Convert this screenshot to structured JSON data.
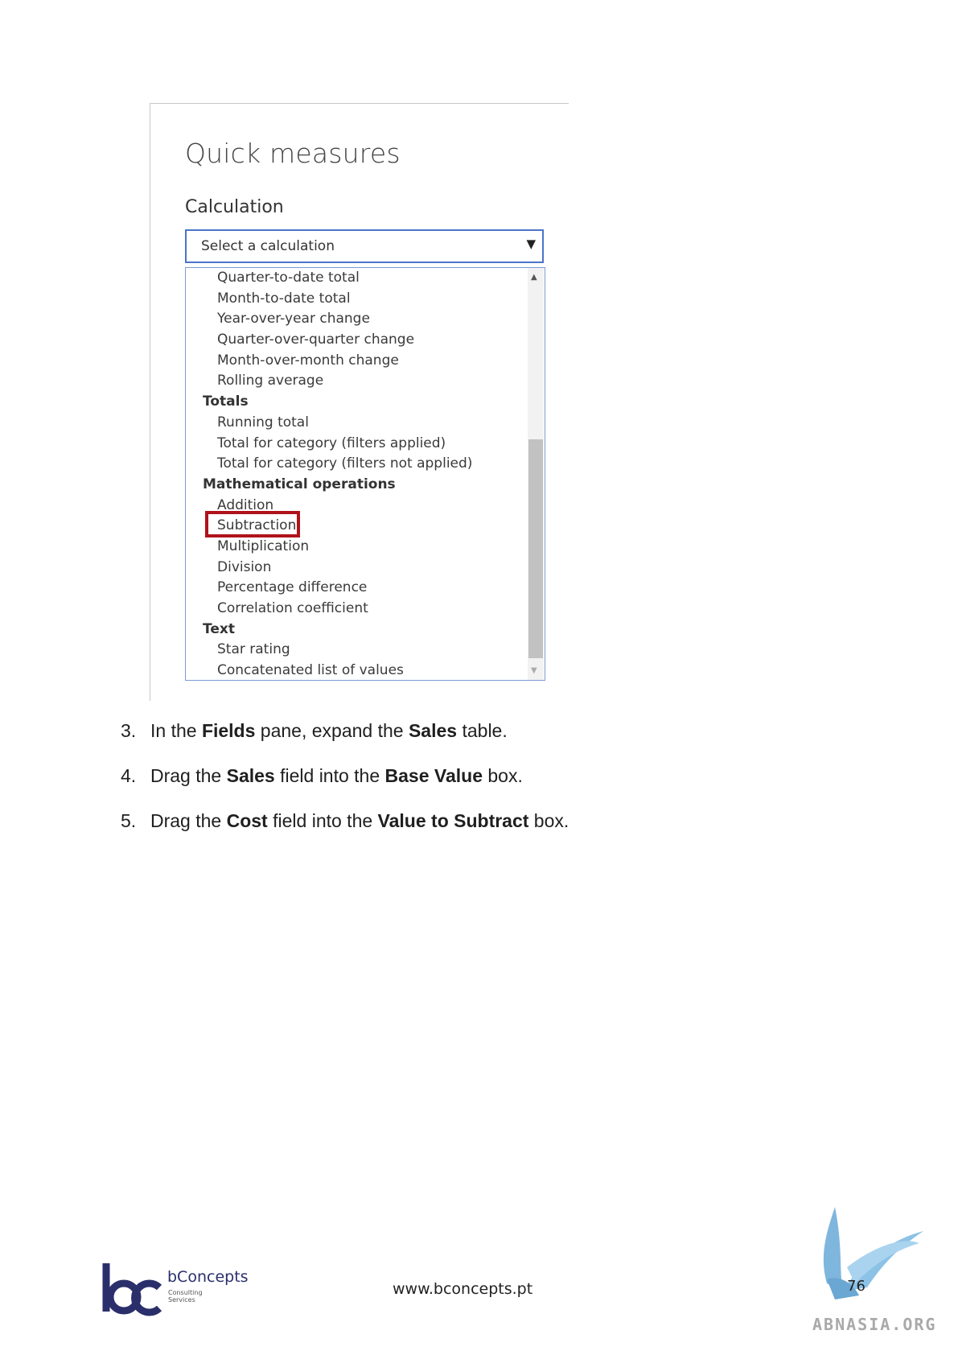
{
  "dialog": {
    "title": "Quick measures",
    "calculation_label": "Calculation",
    "select_placeholder": "Select a calculation",
    "list": [
      {
        "type": "item",
        "label": "Quarter-to-date total"
      },
      {
        "type": "item",
        "label": "Month-to-date total"
      },
      {
        "type": "item",
        "label": "Year-over-year change"
      },
      {
        "type": "item",
        "label": "Quarter-over-quarter change"
      },
      {
        "type": "item",
        "label": "Month-over-month change"
      },
      {
        "type": "item",
        "label": "Rolling average"
      },
      {
        "type": "group",
        "label": "Totals"
      },
      {
        "type": "item",
        "label": "Running total"
      },
      {
        "type": "item",
        "label": "Total for category (filters applied)"
      },
      {
        "type": "item",
        "label": "Total for category (filters not applied)"
      },
      {
        "type": "group",
        "label": "Mathematical operations"
      },
      {
        "type": "item",
        "label": "Addition"
      },
      {
        "type": "item",
        "label": "Subtraction",
        "highlighted": true
      },
      {
        "type": "item",
        "label": "Multiplication"
      },
      {
        "type": "item",
        "label": "Division"
      },
      {
        "type": "item",
        "label": "Percentage difference"
      },
      {
        "type": "item",
        "label": "Correlation coefficient"
      },
      {
        "type": "group",
        "label": "Text"
      },
      {
        "type": "item",
        "label": "Star rating"
      },
      {
        "type": "item",
        "label": "Concatenated list of values"
      }
    ],
    "highlight_color": "#b0121b",
    "accent_color": "#4a74c9"
  },
  "steps": [
    {
      "num": "3.",
      "parts": [
        {
          "t": "In the ",
          "b": false
        },
        {
          "t": "Fields",
          "b": true
        },
        {
          "t": " pane, expand the ",
          "b": false
        },
        {
          "t": "Sales",
          "b": true
        },
        {
          "t": " table.",
          "b": false
        }
      ]
    },
    {
      "num": "4.",
      "parts": [
        {
          "t": "Drag the ",
          "b": false
        },
        {
          "t": "Sales",
          "b": true
        },
        {
          "t": " field into the ",
          "b": false
        },
        {
          "t": "Base Value",
          "b": true
        },
        {
          "t": " box.",
          "b": false
        }
      ]
    },
    {
      "num": "5.",
      "parts": [
        {
          "t": "Drag the ",
          "b": false
        },
        {
          "t": "Cost",
          "b": true
        },
        {
          "t": " field into the ",
          "b": false
        },
        {
          "t": "Value to Subtract",
          "b": true
        },
        {
          "t": " box.",
          "b": false
        }
      ]
    }
  ],
  "footer": {
    "brand_name": "bConcepts",
    "brand_sub1": "Consulting",
    "brand_sub2": "Services",
    "url": "www.bconcepts.pt",
    "page_number": "76",
    "watermark": "ABNASIA.ORG",
    "brand_color": "#2a2f6b"
  },
  "icons": [
    "dropdown-arrow-icon",
    "scroll-up-icon",
    "scroll-down-icon",
    "bconcepts-logo-icon",
    "griffin-icon"
  ]
}
